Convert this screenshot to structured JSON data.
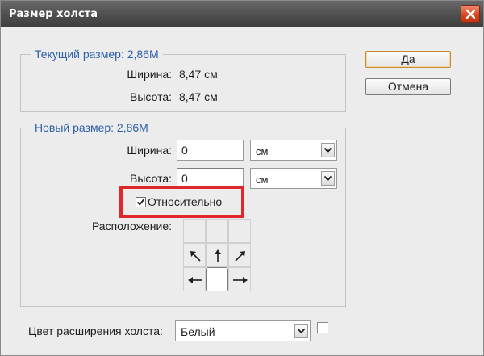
{
  "dialog": {
    "title": "Размер холста",
    "ok_label": "Да",
    "cancel_label": "Отмена"
  },
  "current_size": {
    "legend": "Текущий размер: 2,86M",
    "width_label": "Ширина:",
    "width_value": "8,47 см",
    "height_label": "Высота:",
    "height_value": "8,47 см"
  },
  "new_size": {
    "legend": "Новый размер: 2,86M",
    "width_label": "Ширина:",
    "width_value": "0",
    "width_unit": "см",
    "height_label": "Высота:",
    "height_value": "0",
    "height_unit": "см",
    "relative_label": "Относительно",
    "relative_checked": true,
    "anchor_label": "Расположение:",
    "anchor_selected": "center"
  },
  "extension": {
    "label": "Цвет расширения холста:",
    "value": "Белый",
    "swatch_color": "#ffffff"
  },
  "colors": {
    "highlight": "#e0282a",
    "legend_blue": "#2c5fa8",
    "close_red": "#d9421b"
  },
  "icons": [
    "close-icon",
    "chevron-down-icon",
    "check-icon",
    "arrow-up-left-icon",
    "arrow-up-icon",
    "arrow-up-right-icon",
    "arrow-left-icon",
    "arrow-right-icon"
  ]
}
